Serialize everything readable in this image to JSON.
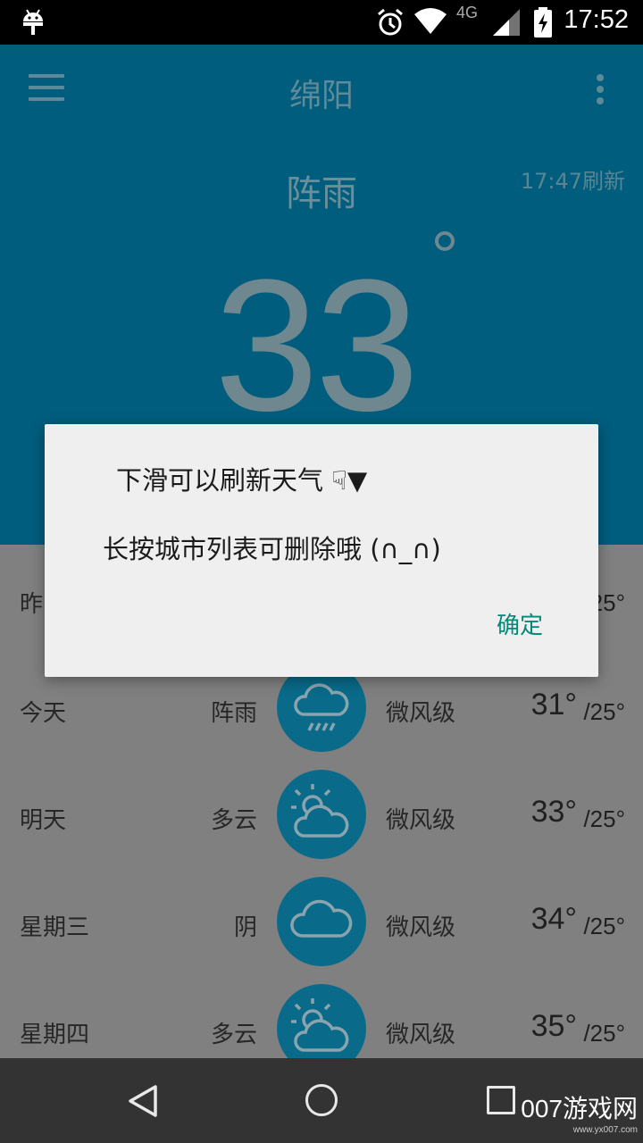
{
  "status_bar": {
    "time": "17:52",
    "network": "4G"
  },
  "header": {
    "city": "绵阳",
    "condition": "阵雨",
    "refresh_time": "17:47刷新",
    "temperature": "33"
  },
  "forecast": [
    {
      "day": "昨",
      "condition": "",
      "wind": "",
      "high": "",
      "low": "25°",
      "icon": ""
    },
    {
      "day": "今天",
      "condition": "阵雨",
      "wind": "微风级",
      "high": "31°",
      "low": "/25°",
      "icon": "rain-cloud-icon"
    },
    {
      "day": "明天",
      "condition": "多云",
      "wind": "微风级",
      "high": "33°",
      "low": "/25°",
      "icon": "sun-cloud-icon"
    },
    {
      "day": "星期三",
      "condition": "阴",
      "wind": "微风级",
      "high": "34°",
      "low": "/25°",
      "icon": "cloud-icon"
    },
    {
      "day": "星期四",
      "condition": "多云",
      "wind": "微风级",
      "high": "35°",
      "low": "/25°",
      "icon": "sun-cloud-icon"
    }
  ],
  "dialog": {
    "line1": "下滑可以刷新天气 ☟▼",
    "line2": "长按城市列表可删除哦 (∩_∩)",
    "ok_label": "确定"
  },
  "watermark": {
    "main": "007游戏网",
    "sub": "www.yx007.com"
  }
}
